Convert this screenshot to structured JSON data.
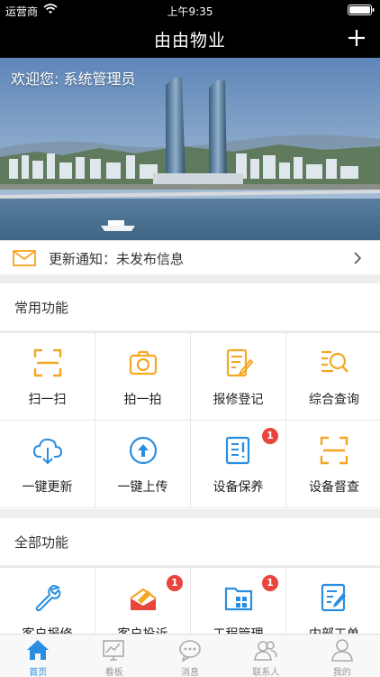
{
  "status_bar": {
    "carrier": "运营商",
    "time": "上午9:35"
  },
  "nav": {
    "title": "由由物业"
  },
  "banner": {
    "welcome": "欢迎您: 系统管理员"
  },
  "notice": {
    "text": "更新通知：未发布信息"
  },
  "common": {
    "title": "常用功能",
    "items": [
      {
        "label": "扫一扫",
        "icon": "scan-icon"
      },
      {
        "label": "拍一拍",
        "icon": "camera-icon"
      },
      {
        "label": "报修登记",
        "icon": "repair-register-icon"
      },
      {
        "label": "综合查询",
        "icon": "search-list-icon"
      },
      {
        "label": "一键更新",
        "icon": "cloud-download-icon"
      },
      {
        "label": "一键上传",
        "icon": "upload-icon"
      },
      {
        "label": "设备保养",
        "icon": "maintenance-icon",
        "badge": "1"
      },
      {
        "label": "设备督查",
        "icon": "inspect-scan-icon"
      }
    ]
  },
  "all": {
    "title": "全部功能",
    "items": [
      {
        "label": "客户报修",
        "icon": "wrench-icon"
      },
      {
        "label": "客户投诉",
        "icon": "complaint-icon",
        "badge": "1"
      },
      {
        "label": "工程管理",
        "icon": "project-folder-icon",
        "badge": "1"
      },
      {
        "label": "内部工单",
        "icon": "work-order-icon"
      }
    ]
  },
  "tabbar": [
    {
      "label": "首页",
      "icon": "home-icon",
      "active": true
    },
    {
      "label": "看板",
      "icon": "dashboard-icon"
    },
    {
      "label": "消息",
      "icon": "message-icon"
    },
    {
      "label": "联系人",
      "icon": "contacts-icon"
    },
    {
      "label": "我的",
      "icon": "profile-icon"
    }
  ],
  "colors": {
    "accent_orange": "#f5a623",
    "accent_blue": "#2a8ee0",
    "badge_red": "#e8453c"
  }
}
